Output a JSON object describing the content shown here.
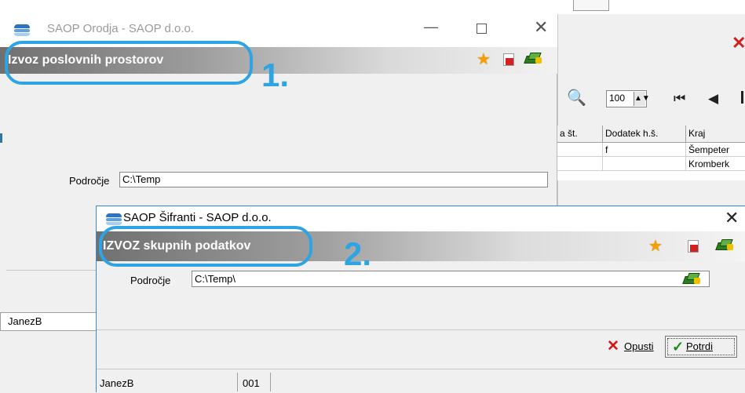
{
  "background_app": {
    "close_glyph": "✕",
    "zoom_value": "100",
    "zoom_spin_glyph": "▲▼",
    "nav_first_glyph": "⏮",
    "nav_prev_glyph": "◀",
    "grid": {
      "columns": [
        "a št.",
        "Dodatek h.š.",
        "Kraj"
      ],
      "rows": [
        [
          "",
          "f",
          "Šempeter"
        ],
        [
          "",
          "",
          "Kromberk"
        ]
      ]
    }
  },
  "window1": {
    "title": "SAOP Orodja - SAOP d.o.o.",
    "header_title": "Izvoz poslovnih prostorov",
    "minimize_glyph": "—",
    "close_glyph": "✕",
    "field_label": "Področje",
    "field_value": "C:\\Temp",
    "status_user": "JanezB"
  },
  "window2": {
    "title": "SAOP Šifranti - SAOP d.o.o.",
    "header_title": "IZVOZ skupnih podatkov",
    "close_glyph": "✕",
    "field_label": "Področje",
    "field_value": "C:\\Temp\\",
    "cancel_label": "Opusti",
    "cancel_glyph": "✕",
    "confirm_label": "Potrdi",
    "confirm_glyph": "✓",
    "status_user": "JanezB",
    "status_code": "001"
  },
  "callouts": {
    "first_number": "1.",
    "second_number": "2."
  },
  "icons": {
    "favorite": "star-icon",
    "close_doc": "close-document-icon",
    "help": "help-book-icon",
    "browse": "folder-browse-icon",
    "logo": "saop-logo-icon"
  },
  "colors": {
    "callout": "#2ea4e2",
    "cancel_icon": "#d31616",
    "confirm_icon": "#1a8a1a",
    "star": "#f5a000"
  }
}
